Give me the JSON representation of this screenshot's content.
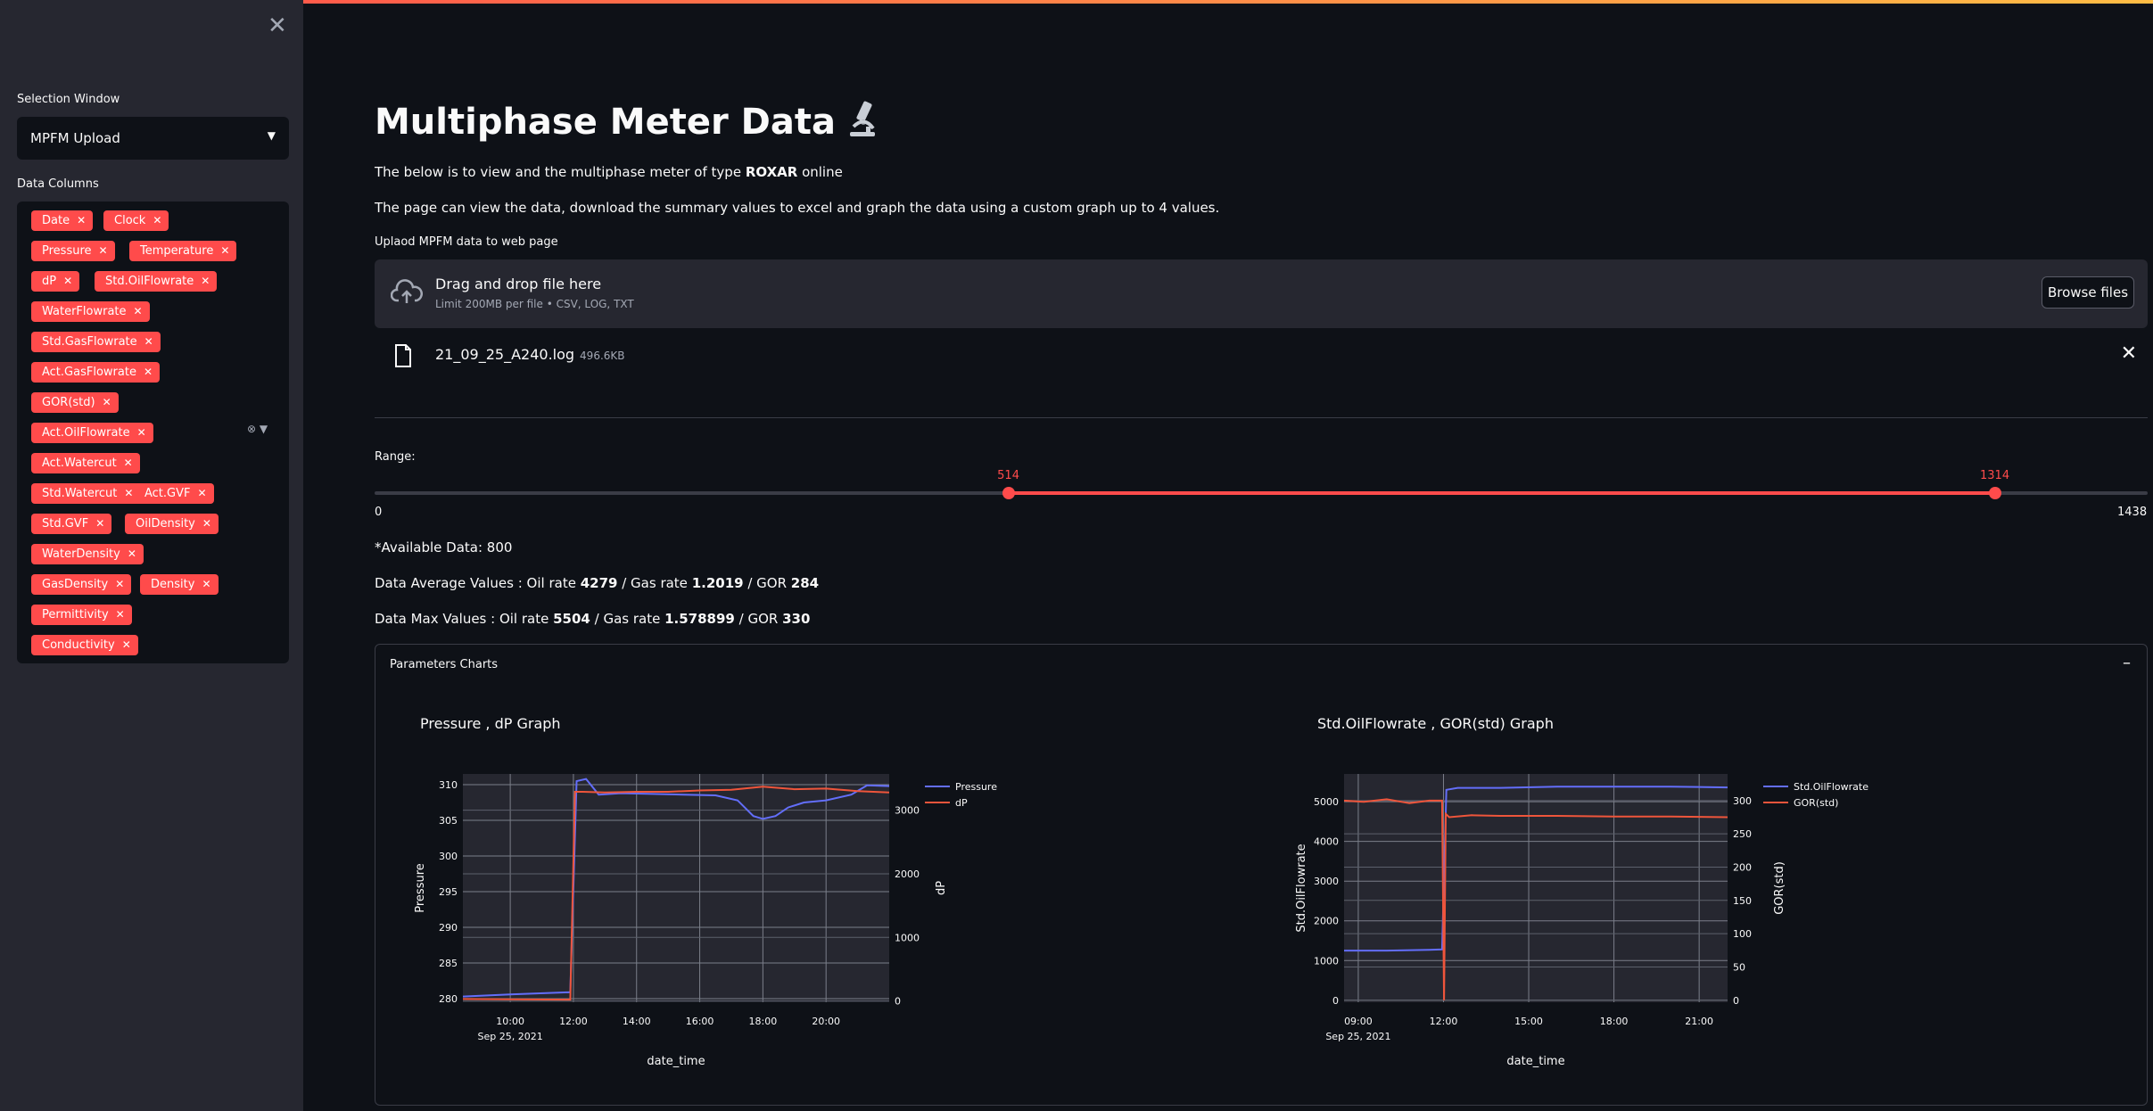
{
  "sidebar": {
    "close_icon": "close-icon",
    "selection_label": "Selection Window",
    "selection_value": "MPFM Upload",
    "columns_label": "Data Columns",
    "tags": [
      "Date",
      "Clock",
      "Pressure",
      "Temperature",
      "dP",
      "Std.OilFlowrate",
      "WaterFlowrate",
      "Std.GasFlowrate",
      "Act.GasFlowrate",
      "GOR(std)",
      "Act.OilFlowrate",
      "Act.Watercut",
      "Std.Watercut",
      "Act.GVF",
      "Std.GVF",
      "OilDensity",
      "WaterDensity",
      "GasDensity",
      "Density",
      "Permittivity",
      "Conductivity"
    ],
    "accent": "#ff4b4b"
  },
  "main": {
    "title": "Multiphase Meter Data",
    "title_icon": "microscope-icon",
    "intro_pre": "The below is to view and the multiphase meter of type ",
    "intro_bold": "ROXAR",
    "intro_post": " online",
    "intro2": "The page can view the data, download the summary values to excel and graph the data using a custom graph up to 4 values.",
    "upload_label": "Uplaod MPFM data to web page",
    "dropzone_title": "Drag and drop file here",
    "dropzone_sub": "Limit 200MB per file • CSV, LOG, TXT",
    "browse_label": "Browse files",
    "file_name": "21_09_25_A240.log",
    "file_size": "496.6KB",
    "range_label": "Range:",
    "range_min": 0,
    "range_max": 1438,
    "range_low": 514,
    "range_high": 1314,
    "available": "*Available Data: 800",
    "avg_pre": "Data Average Values : Oil rate ",
    "avg_oil": "4279",
    "avg_mid": " / Gas rate ",
    "avg_gas": "1.2019",
    "avg_mid2": " / GOR ",
    "avg_gor": "284",
    "max_pre": "Data Max Values : Oil rate ",
    "max_oil": "5504",
    "max_mid": " / Gas rate ",
    "max_gas": "1.578899",
    "max_mid2": " / GOR ",
    "max_gor": "330",
    "expander_title": "Parameters Charts",
    "expander_toggle": "–"
  },
  "chart_data": [
    {
      "type": "line",
      "title": "Pressure , dP Graph",
      "xlabel": "date_time",
      "x_ticks": [
        "10:00",
        "12:00",
        "14:00",
        "16:00",
        "18:00",
        "20:00"
      ],
      "x_ticks_hours": [
        10,
        12,
        14,
        16,
        18,
        20
      ],
      "x_date_label": "Sep 25, 2021",
      "xlim_hours": [
        8.5,
        22
      ],
      "y_left": {
        "label": "Pressure",
        "lim": [
          279.5,
          311.5
        ],
        "ticks": [
          280,
          285,
          290,
          295,
          300,
          305,
          310
        ]
      },
      "y_right": {
        "label": "dP",
        "lim": [
          -20,
          3570
        ],
        "ticks": [
          0,
          1000,
          2000,
          3000
        ]
      },
      "series": [
        {
          "name": "Pressure",
          "color": "#636efa",
          "axis": "left",
          "x": [
            8.5,
            10,
            11.9,
            12.1,
            12.4,
            12.8,
            13.5,
            14.5,
            15.5,
            16.5,
            17.2,
            17.7,
            18.0,
            18.4,
            18.8,
            19.3,
            20.0,
            20.8,
            21.3,
            22
          ],
          "y": [
            280.3,
            280.6,
            280.9,
            310.5,
            310.8,
            308.6,
            308.8,
            308.7,
            308.6,
            308.5,
            307.8,
            305.6,
            305.2,
            305.6,
            306.8,
            307.5,
            307.8,
            308.6,
            309.9,
            309.8
          ]
        },
        {
          "name": "dP",
          "color": "#ef553b",
          "axis": "right",
          "x": [
            8.5,
            10,
            11.9,
            12.05,
            12.3,
            13,
            14,
            15,
            16,
            17,
            18,
            19,
            20,
            21,
            22
          ],
          "y": [
            30,
            25,
            20,
            3290,
            3290,
            3280,
            3290,
            3290,
            3310,
            3320,
            3370,
            3330,
            3340,
            3300,
            3280
          ]
        }
      ]
    },
    {
      "type": "line",
      "title": "Std.OilFlowrate , GOR(std) Graph",
      "xlabel": "date_time",
      "x_ticks": [
        "09:00",
        "12:00",
        "15:00",
        "18:00",
        "21:00"
      ],
      "x_ticks_hours": [
        9,
        12,
        15,
        18,
        21
      ],
      "x_date_label": "Sep 25, 2021",
      "xlim_hours": [
        8.5,
        22
      ],
      "y_left": {
        "label": "Std.OilFlowrate",
        "lim": [
          -50,
          5700
        ],
        "ticks": [
          0,
          1000,
          2000,
          3000,
          4000,
          5000
        ]
      },
      "y_right": {
        "label": "GOR(std)",
        "lim": [
          -3,
          340
        ],
        "ticks": [
          0,
          50,
          100,
          150,
          200,
          250,
          300
        ]
      },
      "series": [
        {
          "name": "Std.OilFlowrate",
          "color": "#636efa",
          "axis": "left",
          "x": [
            8.5,
            10,
            11.5,
            11.95,
            12.1,
            12.5,
            14,
            16,
            18,
            20,
            22
          ],
          "y": [
            1250,
            1250,
            1270,
            1280,
            5300,
            5350,
            5350,
            5380,
            5380,
            5380,
            5360
          ]
        },
        {
          "name": "GOR(std)",
          "color": "#ef553b",
          "axis": "right",
          "x": [
            8.5,
            9.2,
            10,
            10.8,
            11.5,
            11.95,
            12.02,
            12.08,
            12.2,
            13,
            14,
            16,
            18,
            20,
            22
          ],
          "y": [
            300,
            298,
            302,
            296,
            300,
            300,
            0,
            280,
            275,
            278,
            277,
            277,
            276,
            276,
            275
          ]
        }
      ]
    }
  ]
}
